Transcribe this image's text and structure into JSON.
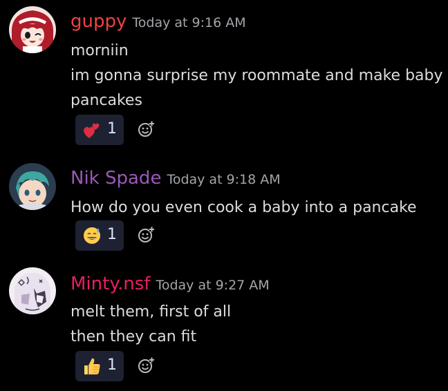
{
  "messages": [
    {
      "username": "guppy",
      "username_color": "#ed4245",
      "timestamp": "Today at 9:16 AM",
      "lines": [
        "morniin",
        "im gonna surprise my roommate and make baby",
        "pancakes"
      ],
      "reaction": {
        "emoji": "heart-exclamation-icon",
        "count": "1"
      }
    },
    {
      "username": "Nik Spade",
      "username_color": "#9b59b6",
      "timestamp": "Today at 9:18 AM",
      "lines": [
        "How do you even cook a baby into a pancake"
      ],
      "reaction": {
        "emoji": "sweat-smile-icon",
        "count": "1"
      }
    },
    {
      "username": "Minty.nsf",
      "username_color": "#e91e63",
      "timestamp": "Today at 9:27 AM",
      "lines": [
        "melt them, first of all",
        "then they can fit"
      ],
      "reaction": {
        "emoji": "thumbs-up-icon",
        "count": "1"
      }
    }
  ]
}
